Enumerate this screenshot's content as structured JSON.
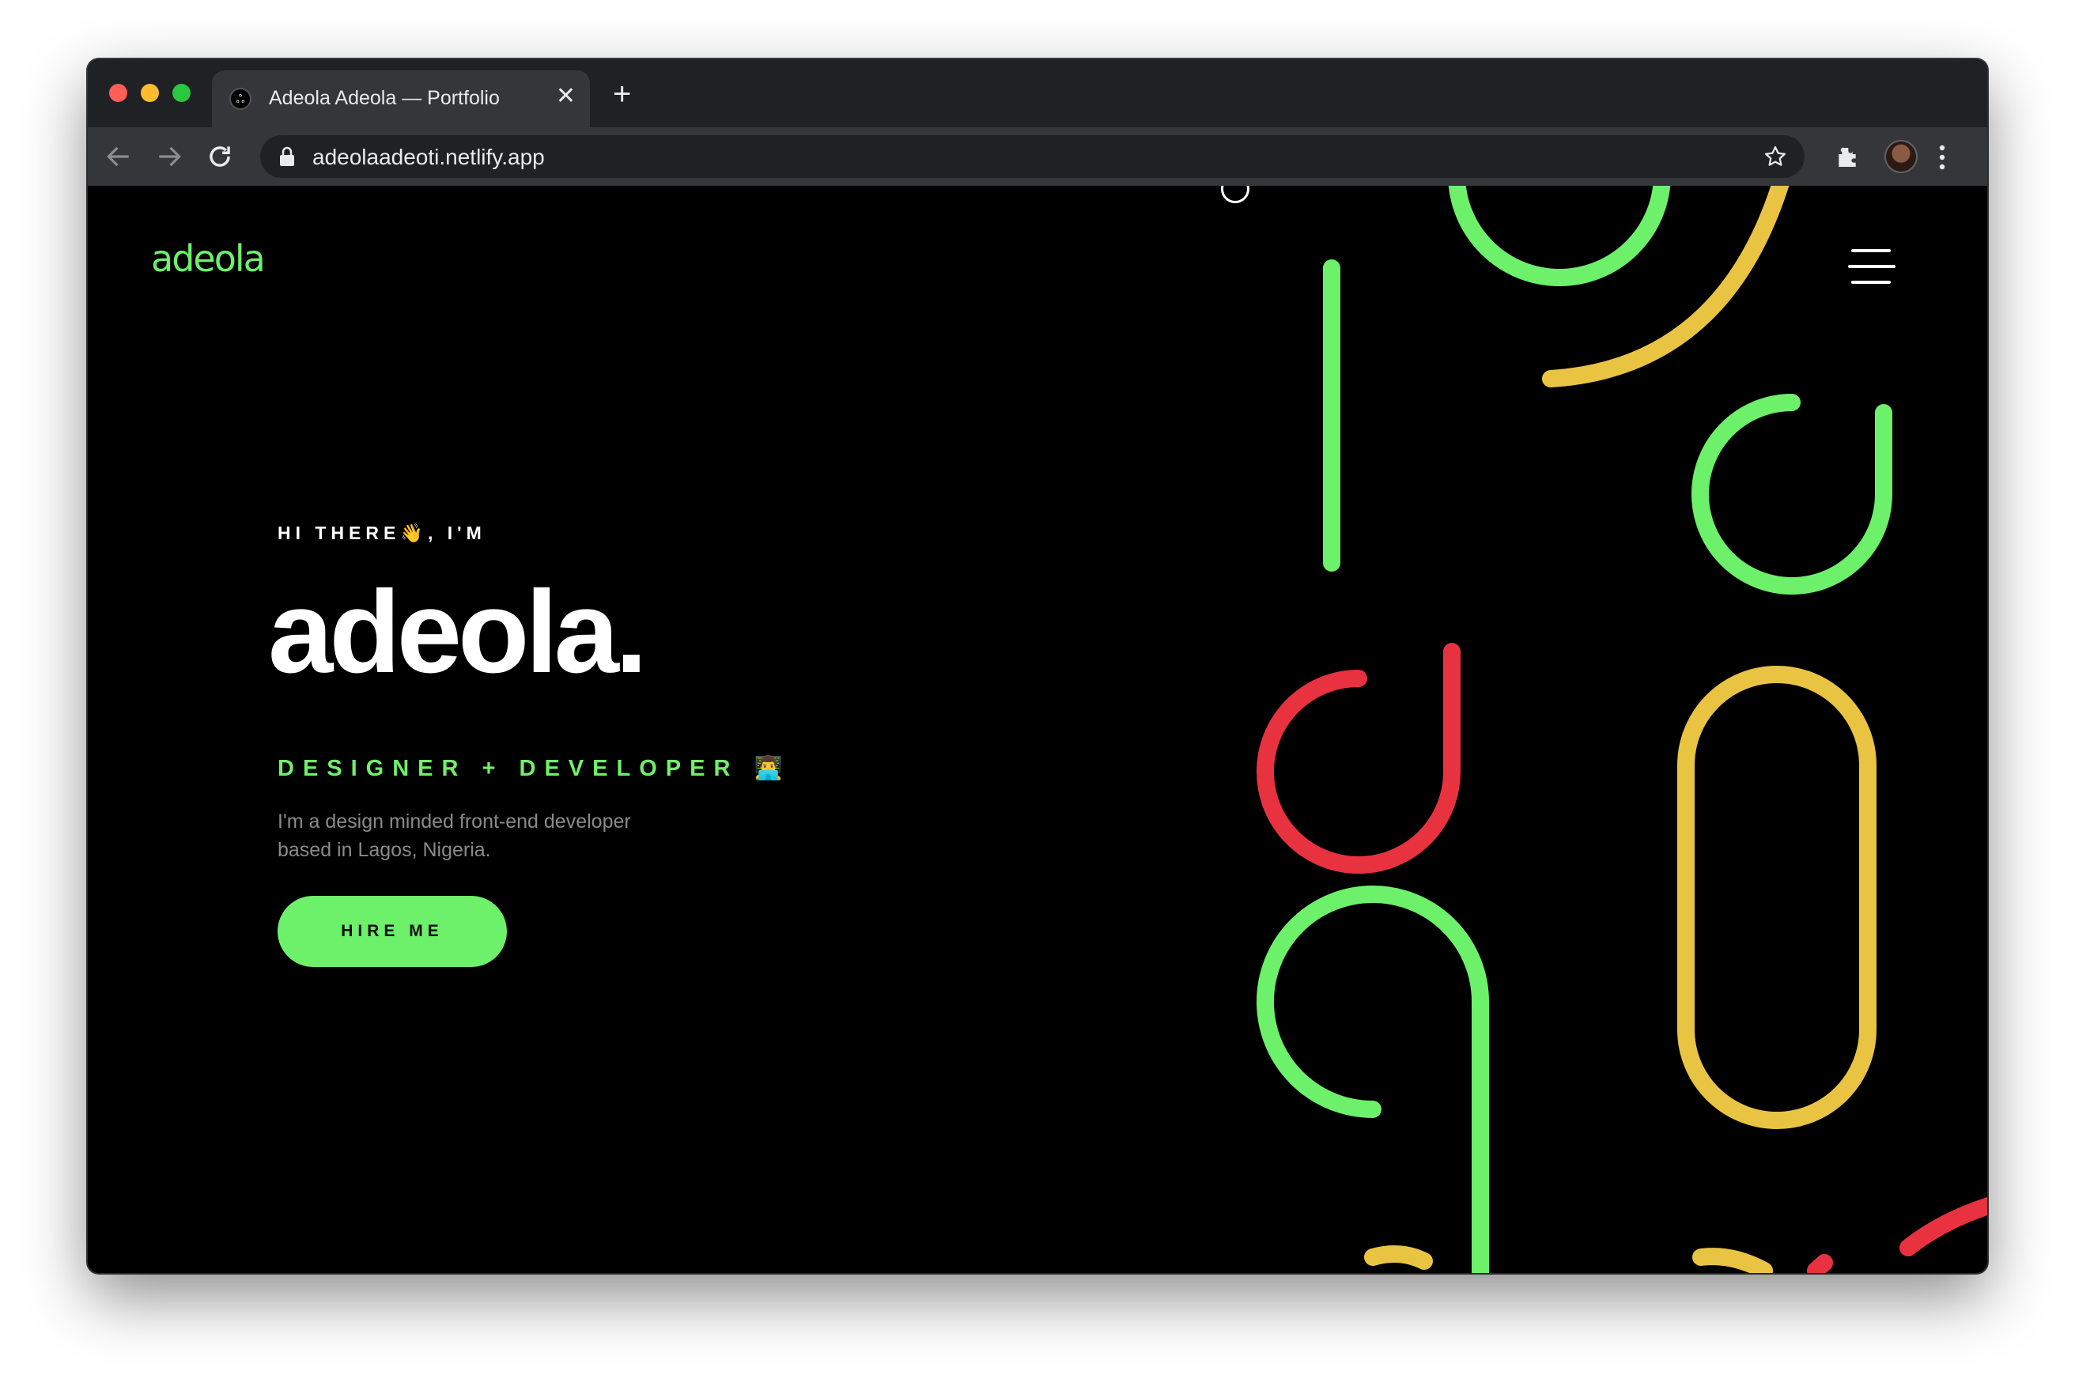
{
  "browser": {
    "tab": {
      "title": "Adeola Adeola — Portfolio",
      "close_glyph": "✕",
      "favicon_glyph": "ஃ"
    },
    "new_tab_glyph": "+",
    "address": {
      "url": "adeolaadeoti.netlify.app"
    }
  },
  "site": {
    "logo_text": "adeola",
    "hero": {
      "greeting": "HI THERE👋, I'M",
      "name": "adeola.",
      "role": "DESIGNER + DEVELOPER 👨‍💻",
      "intro": "I'm a design minded front-end developer based in Lagos, Nigeria.",
      "cta": "HIRE ME"
    }
  },
  "colors": {
    "accent_green": "#6df06a",
    "accent_red": "#e8323f",
    "accent_yellow": "#e9c443",
    "background": "#000000",
    "browser_dark": "#202124",
    "browser_toolbar": "#35363a"
  },
  "icons": [
    "back-arrow-icon",
    "forward-arrow-icon",
    "reload-icon",
    "lock-icon",
    "star-icon",
    "puzzle-extension-icon",
    "profile-avatar",
    "more-vert-icon",
    "hamburger-menu-icon"
  ]
}
